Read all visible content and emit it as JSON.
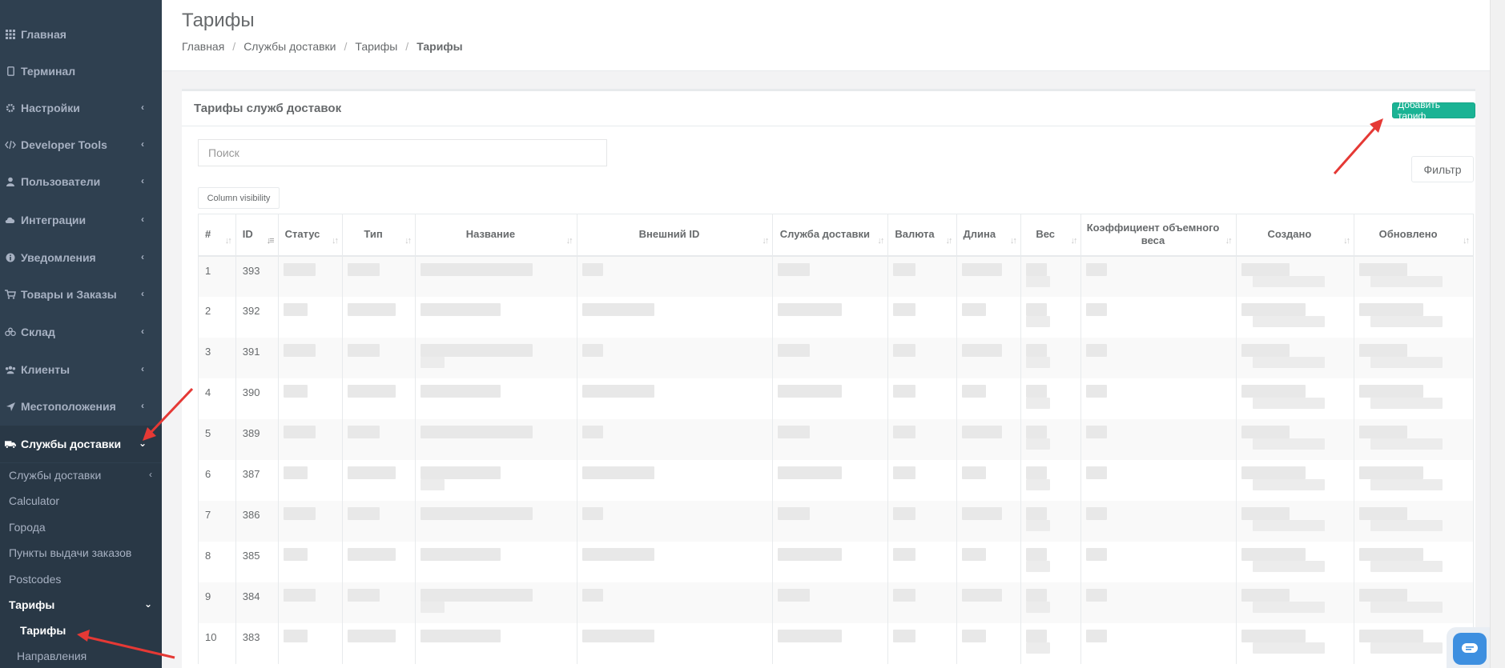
{
  "sidebar": {
    "items": [
      {
        "label": "Главная",
        "icon": "grid-icon"
      },
      {
        "label": "Терминал",
        "icon": "tablet-icon"
      },
      {
        "label": "Настройки",
        "icon": "gear-icon"
      },
      {
        "label": "Developer Tools",
        "icon": "code-icon"
      },
      {
        "label": "Пользователи",
        "icon": "user-icon"
      },
      {
        "label": "Интеграции",
        "icon": "cloud-icon"
      },
      {
        "label": "Уведомления",
        "icon": "info-icon"
      },
      {
        "label": "Товары и Заказы",
        "icon": "cart-icon"
      },
      {
        "label": "Склад",
        "icon": "cubes-icon"
      },
      {
        "label": "Клиенты",
        "icon": "users-icon"
      },
      {
        "label": "Местоположения",
        "icon": "location-arrow-icon"
      },
      {
        "label": "Службы доставки",
        "icon": "truck-icon"
      }
    ],
    "sub_items": [
      {
        "label": "Службы доставки"
      },
      {
        "label": "Calculator"
      },
      {
        "label": "Города"
      },
      {
        "label": "Пункты выдачи заказов"
      },
      {
        "label": "Postcodes"
      },
      {
        "label": "Тарифы"
      },
      {
        "label": "Тарифы"
      },
      {
        "label": "Направления"
      }
    ]
  },
  "header": {
    "title": "Тарифы",
    "breadcrumb": [
      "Главная",
      "Службы доставки",
      "Тарифы",
      "Тарифы"
    ]
  },
  "panel": {
    "title": "Тарифы служб доставок",
    "add_button": "Добавить тариф",
    "search_placeholder": "Поиск",
    "filter_button": "Фильтр",
    "column_visibility": "Column visibility"
  },
  "table": {
    "columns": [
      "#",
      "ID",
      "Статус",
      "Тип",
      "Название",
      "Внешний ID",
      "Служба доставки",
      "Валюта",
      "Длина",
      "Вес",
      "Коэффициент объемного веса",
      "Создано",
      "Обновлено"
    ],
    "rows": [
      {
        "n": "1",
        "id": "393"
      },
      {
        "n": "2",
        "id": "392"
      },
      {
        "n": "3",
        "id": "391"
      },
      {
        "n": "4",
        "id": "390"
      },
      {
        "n": "5",
        "id": "389"
      },
      {
        "n": "6",
        "id": "387"
      },
      {
        "n": "7",
        "id": "386"
      },
      {
        "n": "8",
        "id": "385"
      },
      {
        "n": "9",
        "id": "384"
      },
      {
        "n": "10",
        "id": "383"
      }
    ]
  },
  "colors": {
    "sidebar_bg": "#2f4050",
    "accent": "#1ab394",
    "arrow": "#e53935"
  }
}
